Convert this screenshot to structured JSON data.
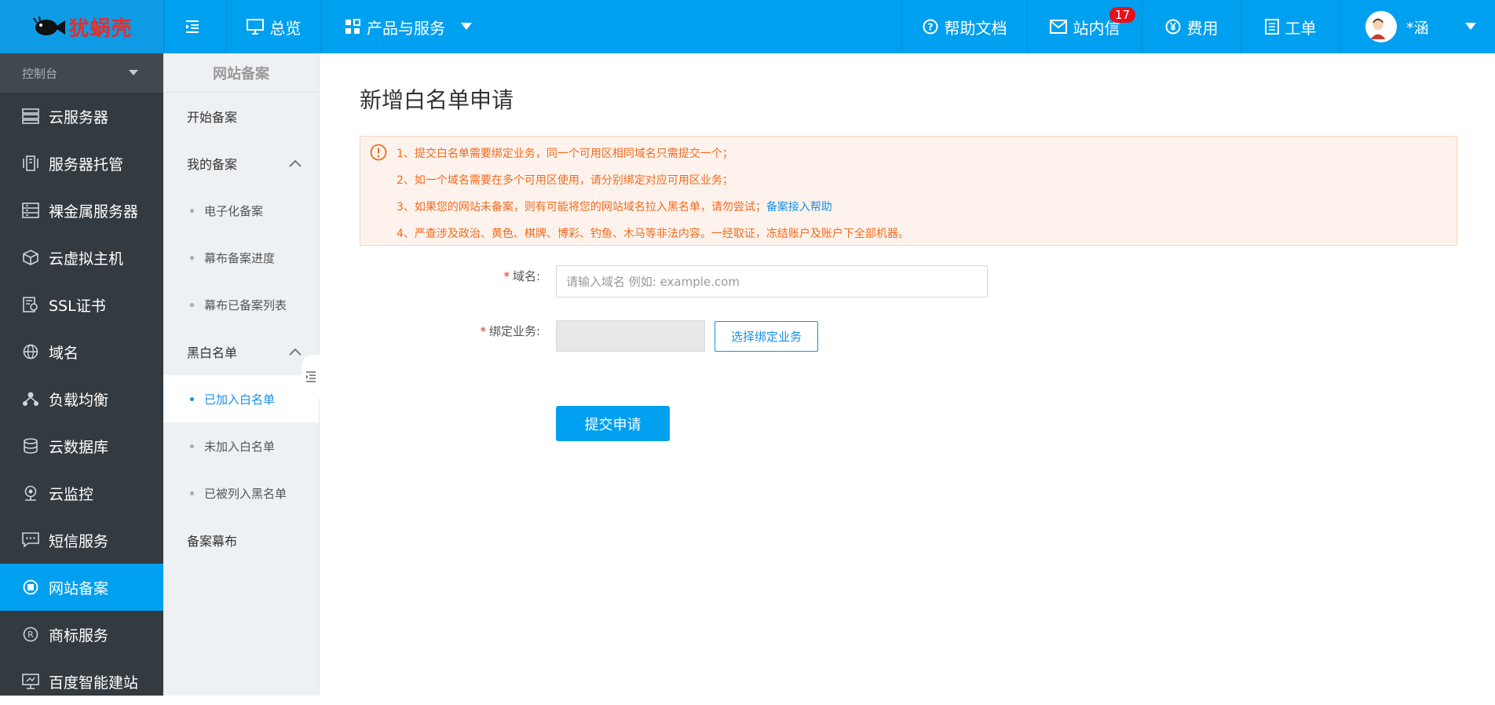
{
  "logo": {
    "text": "犹蜗壳"
  },
  "topbar": {
    "overview": "总览",
    "products": "产品与服务",
    "help": "帮助文档",
    "messages": "站内信",
    "messages_badge": "17",
    "billing": "费用",
    "tickets": "工单",
    "user": "*涵"
  },
  "sidebar": {
    "console": "控制台",
    "items": [
      {
        "label": "云服务器",
        "icon": "server-icon"
      },
      {
        "label": "服务器托管",
        "icon": "hosting-icon"
      },
      {
        "label": "裸金属服务器",
        "icon": "baremetal-icon"
      },
      {
        "label": "云虚拟主机",
        "icon": "cube-icon"
      },
      {
        "label": "SSL证书",
        "icon": "certificate-icon"
      },
      {
        "label": "域名",
        "icon": "globe-icon"
      },
      {
        "label": "负载均衡",
        "icon": "balance-icon"
      },
      {
        "label": "云数据库",
        "icon": "database-icon"
      },
      {
        "label": "云监控",
        "icon": "camera-icon"
      },
      {
        "label": "短信服务",
        "icon": "message-icon"
      },
      {
        "label": "网站备案",
        "icon": "record-icon",
        "active": true
      },
      {
        "label": "商标服务",
        "icon": "trademark-icon"
      },
      {
        "label": "百度智能建站",
        "icon": "monitor-icon"
      }
    ]
  },
  "submenu": {
    "title": "网站备案",
    "start": "开始备案",
    "my_record": "我的备案",
    "my_items": [
      "电子化备案",
      "幕布备案进度",
      "幕布已备案列表"
    ],
    "blackwhite": "黑白名单",
    "bw_items": [
      "已加入白名单",
      "未加入白名单",
      "已被列入黑名单"
    ],
    "curtain": "备案幕布"
  },
  "main": {
    "title": "新增白名单申请",
    "notice": [
      "1、提交白名单需要绑定业务，同一个可用区相同域名只需提交一个；",
      "2、如一个域名需要在多个可用区使用，请分别绑定对应可用区业务；",
      "3、如果您的网站未备案，则有可能将您的网站域名拉入黑名单，请勿尝试；",
      "4、严查涉及政治、黄色、棋牌、博彩、钓鱼、木马等非法内容。一经取证，冻结账户及账户下全部机器。"
    ],
    "notice_link": "备案接入帮助",
    "domain_label": "域名:",
    "domain_placeholder": "请输入域名 例如: example.com",
    "domain_value": "",
    "bind_label": "绑定业务:",
    "bind_button": "选择绑定业务",
    "submit": "提交申请"
  },
  "colors": {
    "primary": "#00a0f0",
    "sidebar": "#333a40",
    "warning": "#f06a20",
    "link": "#1890e8"
  }
}
